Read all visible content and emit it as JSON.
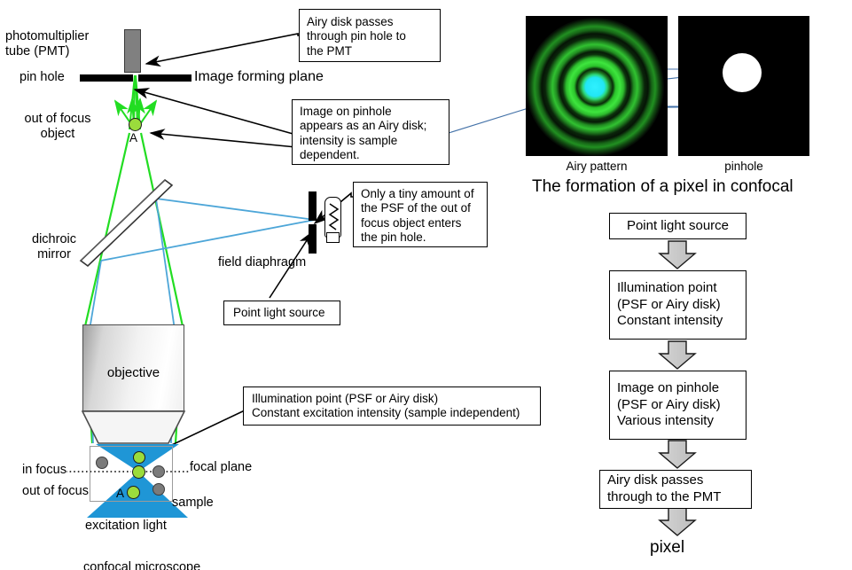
{
  "diagram": {
    "title_right": "The formation of a pixel in confocal",
    "bottom_caption": "confocal microscope"
  },
  "left_schematic": {
    "labels": {
      "pmt": "photomultiplier\ntube (PMT)",
      "pin_hole": "pin hole",
      "image_forming_plane": "Image forming plane",
      "out_of_focus_object": "out of focus\nobject",
      "point_a_top": "A",
      "dichroic_mirror": "dichroic\nmirror",
      "field_diaphragm": "field diaphragm",
      "objective": "objective",
      "in_focus": "in focus",
      "out_of_focus": "out of focus",
      "focal_plane": "focal plane",
      "sample": "sample",
      "excitation_light": "excitation light",
      "point_a_sample": "A"
    },
    "callouts": [
      {
        "id": "airy-disk-pmt",
        "text": "Airy disk passes\nthrough pin hole to\nthe PMT"
      },
      {
        "id": "image-on-pinhole",
        "text": "Image on pinhole\nappears as an Airy disk;\nintensity is sample\ndependent."
      },
      {
        "id": "tiny-amount-psf",
        "text": "Only a tiny amount of\nthe PSF of the out of\nfocus object enters\nthe pin hole."
      },
      {
        "id": "point-light-source",
        "text": "Point light source"
      },
      {
        "id": "illumination-point",
        "text": "Illumination point (PSF or Airy disk)\nConstant excitation intensity (sample independent)"
      }
    ]
  },
  "panels": [
    {
      "id": "airy-pattern",
      "caption": "Airy pattern"
    },
    {
      "id": "pinhole",
      "caption": "pinhole"
    }
  ],
  "flowchart": {
    "steps": [
      {
        "id": "point-light-source",
        "text": "Point light source"
      },
      {
        "id": "illumination-point",
        "text": "Illumination point\n(PSF or Airy disk)\nConstant intensity"
      },
      {
        "id": "image-on-pinhole",
        "text": "Image on pinhole\n(PSF or Airy disk)\nVarious intensity"
      },
      {
        "id": "airy-disk-pmt",
        "text": "Airy disk passes\nthrough to the PMT"
      }
    ],
    "result": "pixel"
  },
  "colors": {
    "emission_ray": "#22dd22",
    "excitation_ray": "#4da6d8",
    "sample_cone": "#1f96d6",
    "airy_core": "#27e3f0",
    "airy_ring": "#22cc22",
    "pmt_body": "#808080",
    "marker_green": "#9bdc3c",
    "marker_gray": "#7b7b7b"
  }
}
